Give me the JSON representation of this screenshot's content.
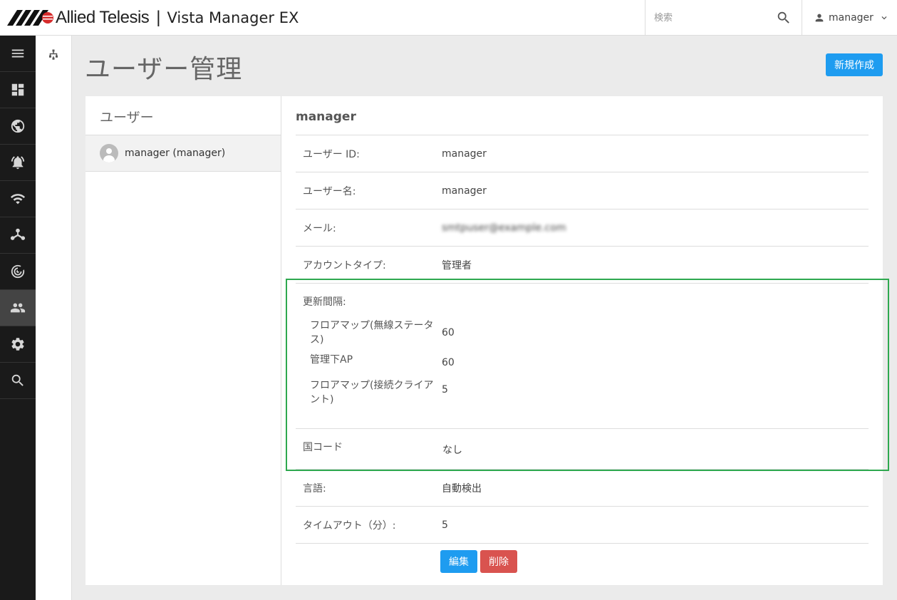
{
  "header": {
    "brand": "Allied Telesis",
    "app_title": "Vista Manager EX",
    "search_placeholder": "検索",
    "user_name": "manager"
  },
  "sidebar": {
    "items": [
      {
        "icon": "menu-icon",
        "active": false
      },
      {
        "icon": "dashboard-icon",
        "active": false
      },
      {
        "icon": "globe-icon",
        "active": false
      },
      {
        "icon": "alarm-bell-icon",
        "active": false
      },
      {
        "icon": "wifi-icon",
        "active": false
      },
      {
        "icon": "topology-icon",
        "active": false
      },
      {
        "icon": "radar-icon",
        "active": false
      },
      {
        "icon": "users-icon",
        "active": true
      },
      {
        "icon": "gear-icon",
        "active": false
      },
      {
        "icon": "search-icon",
        "active": false
      }
    ]
  },
  "page": {
    "title": "ユーザー管理",
    "new_button": "新規作成"
  },
  "users_panel": {
    "heading": "ユーザー",
    "users": [
      {
        "label": "manager (manager)",
        "selected": true
      }
    ]
  },
  "detail": {
    "title": "manager",
    "user_id_label": "ユーザー ID:",
    "user_id": "manager",
    "user_name_label": "ユーザー名:",
    "user_name": "manager",
    "email_label": "メール:",
    "email": "smtpuser@example.com",
    "account_type_label": "アカウントタイプ:",
    "account_type": "管理者",
    "refresh_label": "更新間隔:",
    "refresh": [
      {
        "label": "フロアマップ(無線ステータス)",
        "value": "60"
      },
      {
        "label": "管理下AP",
        "value": "60"
      },
      {
        "label": "フロアマップ(接続クライアント)",
        "value": "5"
      }
    ],
    "country_label": "国コード",
    "country": "なし",
    "language_label": "言語:",
    "language": "自動検出",
    "timeout_label": "タイムアウト（分）:",
    "timeout": "5",
    "edit_button": "編集",
    "delete_button": "削除"
  },
  "colors": {
    "primary": "#1e9cf0",
    "danger": "#d9534f",
    "highlight": "#2ea84f",
    "sidebar_bg": "#1a1a1a"
  }
}
